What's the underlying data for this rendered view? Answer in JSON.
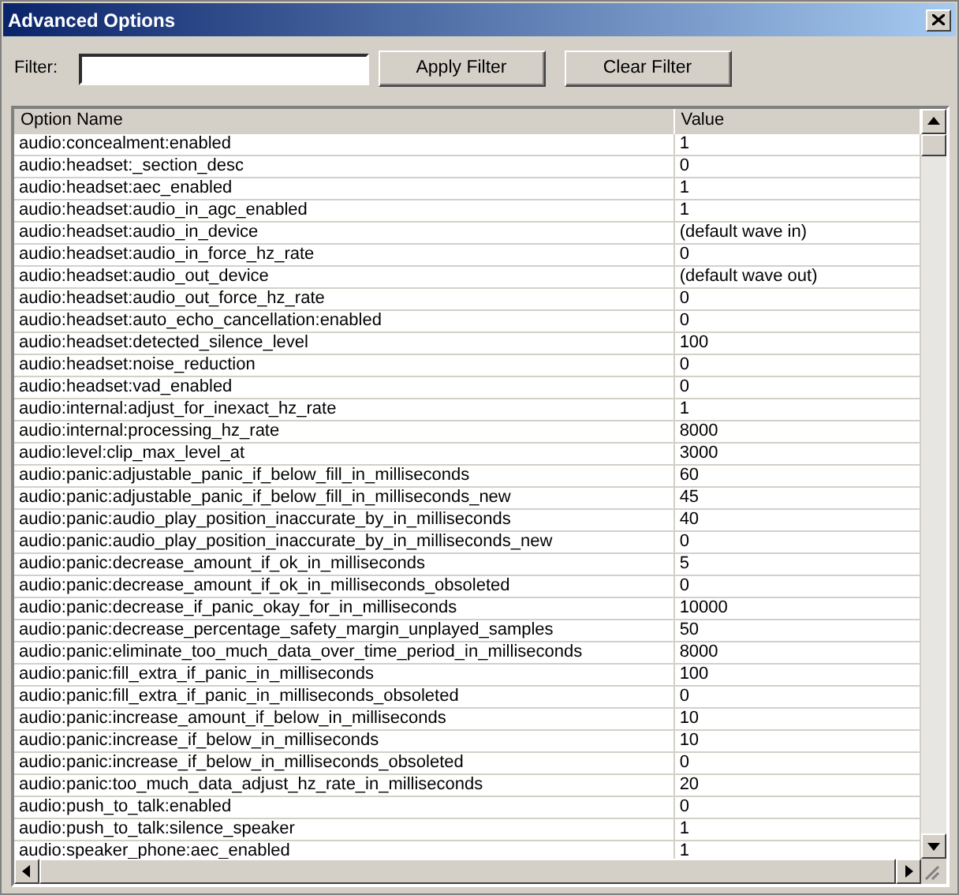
{
  "window": {
    "title": "Advanced Options"
  },
  "filter": {
    "label": "Filter:"
  },
  "buttons": [
    "Apply Filter",
    "Clear Filter"
  ],
  "table": {
    "columns": [
      "Option Name",
      "Value"
    ],
    "rows": [
      [
        "audio:concealment:enabled",
        "1"
      ],
      [
        "audio:headset:_section_desc",
        "0"
      ],
      [
        "audio:headset:aec_enabled",
        "1"
      ],
      [
        "audio:headset:audio_in_agc_enabled",
        "1"
      ],
      [
        "audio:headset:audio_in_device",
        "(default wave in)"
      ],
      [
        "audio:headset:audio_in_force_hz_rate",
        "0"
      ],
      [
        "audio:headset:audio_out_device",
        "(default wave out)"
      ],
      [
        "audio:headset:audio_out_force_hz_rate",
        "0"
      ],
      [
        "audio:headset:auto_echo_cancellation:enabled",
        "0"
      ],
      [
        "audio:headset:detected_silence_level",
        "100"
      ],
      [
        "audio:headset:noise_reduction",
        "0"
      ],
      [
        "audio:headset:vad_enabled",
        "0"
      ],
      [
        "audio:internal:adjust_for_inexact_hz_rate",
        "1"
      ],
      [
        "audio:internal:processing_hz_rate",
        "8000"
      ],
      [
        "audio:level:clip_max_level_at",
        "3000"
      ],
      [
        "audio:panic:adjustable_panic_if_below_fill_in_milliseconds",
        "60"
      ],
      [
        "audio:panic:adjustable_panic_if_below_fill_in_milliseconds_new",
        "45"
      ],
      [
        "audio:panic:audio_play_position_inaccurate_by_in_milliseconds",
        "40"
      ],
      [
        "audio:panic:audio_play_position_inaccurate_by_in_milliseconds_new",
        "0"
      ],
      [
        "audio:panic:decrease_amount_if_ok_in_milliseconds",
        "5"
      ],
      [
        "audio:panic:decrease_amount_if_ok_in_milliseconds_obsoleted",
        "0"
      ],
      [
        "audio:panic:decrease_if_panic_okay_for_in_milliseconds",
        "10000"
      ],
      [
        "audio:panic:decrease_percentage_safety_margin_unplayed_samples",
        "50"
      ],
      [
        "audio:panic:eliminate_too_much_data_over_time_period_in_milliseconds",
        "8000"
      ],
      [
        "audio:panic:fill_extra_if_panic_in_milliseconds",
        "100"
      ],
      [
        "audio:panic:fill_extra_if_panic_in_milliseconds_obsoleted",
        "0"
      ],
      [
        "audio:panic:increase_amount_if_below_in_milliseconds",
        "10"
      ],
      [
        "audio:panic:increase_if_below_in_milliseconds",
        "10"
      ],
      [
        "audio:panic:increase_if_below_in_milliseconds_obsoleted",
        "0"
      ],
      [
        "audio:panic:too_much_data_adjust_hz_rate_in_milliseconds",
        "20"
      ],
      [
        "audio:push_to_talk:enabled",
        "0"
      ],
      [
        "audio:push_to_talk:silence_speaker",
        "1"
      ],
      [
        "audio:speaker_phone:aec_enabled",
        "1"
      ]
    ]
  }
}
